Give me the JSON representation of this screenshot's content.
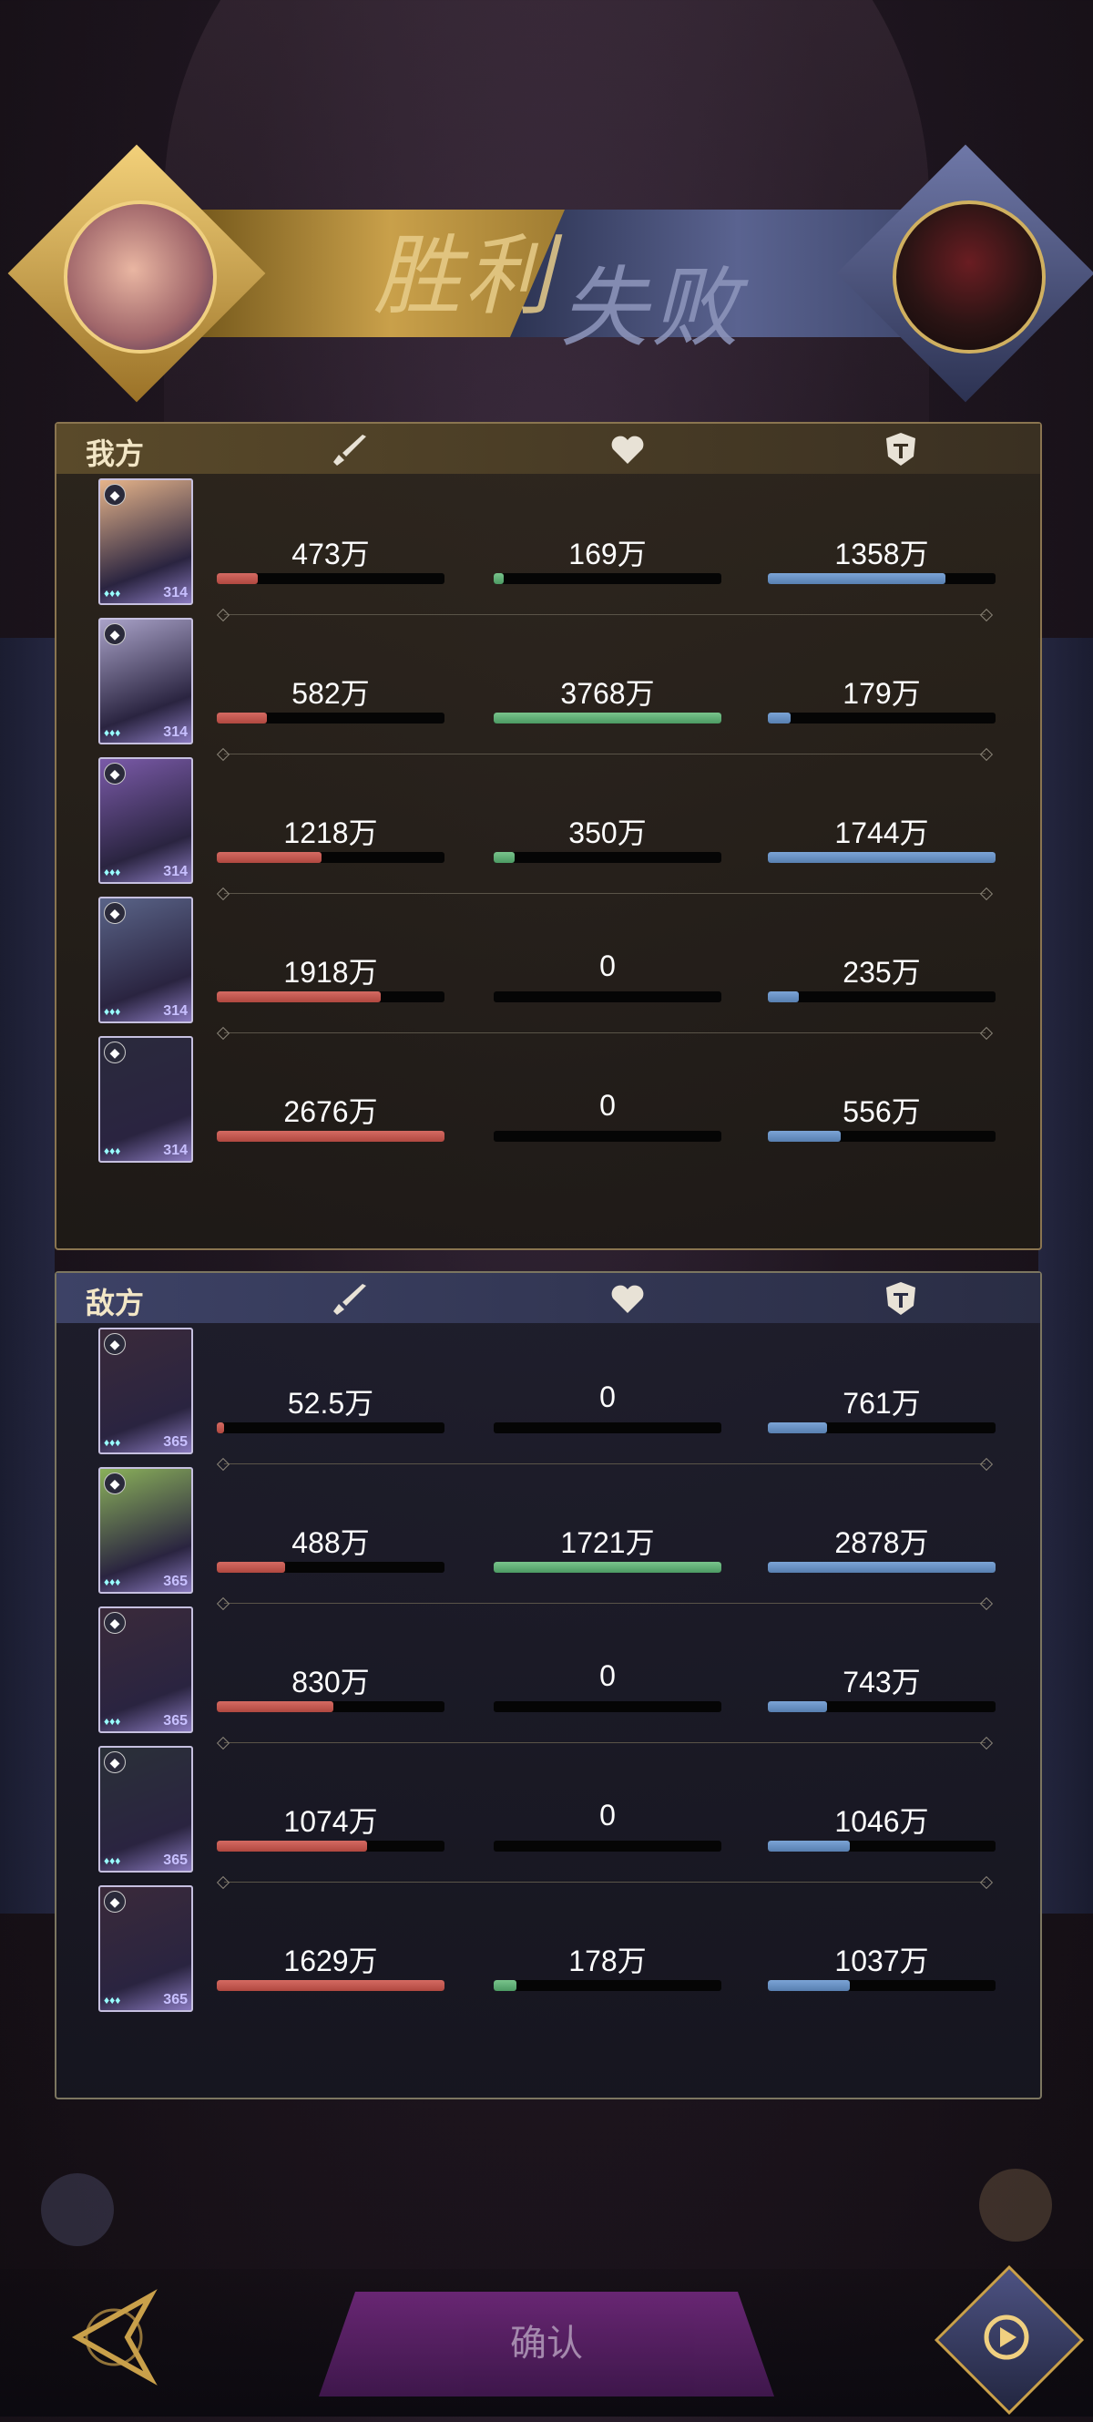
{
  "banner": {
    "win_text": "胜利",
    "lose_text": "失败",
    "left_avatar_icon": "boar-portrait",
    "right_avatar_icon": "anubis-portrait"
  },
  "columns": {
    "attack_icon": "sword-icon",
    "heal_icon": "heart-icon",
    "defense_icon": "shield-icon"
  },
  "ally": {
    "title": "我方",
    "rows": [
      {
        "level": "314",
        "attack": "473万",
        "heal": "169万",
        "defense": "1358万",
        "attack_pct": 0.18,
        "heal_pct": 0.045,
        "defense_pct": 0.78,
        "card_color": "#e6b48a"
      },
      {
        "level": "314",
        "attack": "582万",
        "heal": "3768万",
        "defense": "179万",
        "attack_pct": 0.22,
        "heal_pct": 1.0,
        "defense_pct": 0.1,
        "card_color": "#a9a2c8"
      },
      {
        "level": "314",
        "attack": "1218万",
        "heal": "350万",
        "defense": "1744万",
        "attack_pct": 0.46,
        "heal_pct": 0.09,
        "defense_pct": 1.0,
        "card_color": "#7a5aa8"
      },
      {
        "level": "314",
        "attack": "1918万",
        "heal": "0",
        "defense": "235万",
        "attack_pct": 0.72,
        "heal_pct": 0,
        "defense_pct": 0.135,
        "card_color": "#5a6488"
      },
      {
        "level": "314",
        "attack": "2676万",
        "heal": "0",
        "defense": "556万",
        "attack_pct": 1.0,
        "heal_pct": 0,
        "defense_pct": 0.32,
        "card_color": "#2a2a3c"
      }
    ]
  },
  "enemy": {
    "title": "敌方",
    "rows": [
      {
        "level": "365",
        "attack": "52.5万",
        "heal": "0",
        "defense": "761万",
        "attack_pct": 0.03,
        "heal_pct": 0,
        "defense_pct": 0.26,
        "card_color": "#3a2a3a"
      },
      {
        "level": "365",
        "attack": "488万",
        "heal": "1721万",
        "defense": "2878万",
        "attack_pct": 0.3,
        "heal_pct": 1.0,
        "defense_pct": 1.0,
        "card_color": "#8ab05a"
      },
      {
        "level": "365",
        "attack": "830万",
        "heal": "0",
        "defense": "743万",
        "attack_pct": 0.51,
        "heal_pct": 0,
        "defense_pct": 0.26,
        "card_color": "#3a2a3a"
      },
      {
        "level": "365",
        "attack": "1074万",
        "heal": "0",
        "defense": "1046万",
        "attack_pct": 0.66,
        "heal_pct": 0,
        "defense_pct": 0.36,
        "card_color": "#2a3038"
      },
      {
        "level": "365",
        "attack": "1629万",
        "heal": "178万",
        "defense": "1037万",
        "attack_pct": 1.0,
        "heal_pct": 0.1,
        "defense_pct": 0.36,
        "card_color": "#3a2a3a"
      }
    ]
  },
  "bottom": {
    "confirm_label": "确认",
    "back_icon": "back-arrow-icon",
    "replay_icon": "replay-icon"
  }
}
